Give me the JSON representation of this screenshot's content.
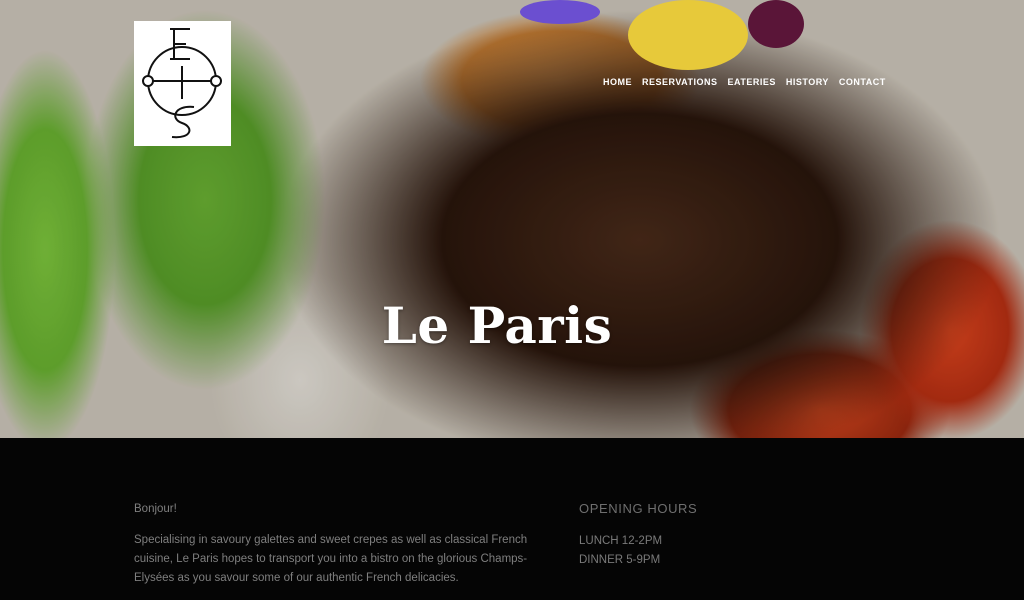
{
  "header": {
    "logo_alt": "LE PARIS monogram logo",
    "nav": [
      "HOME",
      "RESERVATIONS",
      "EATERIES",
      "HISTORY",
      "CONTACT"
    ]
  },
  "hero": {
    "title": "Le Paris"
  },
  "about": {
    "greeting": "Bonjour!",
    "body": "Specialising in savoury galettes and sweet crepes as well as classical French cuisine, Le Paris hopes to transport you into a bistro on the glorious Champs-Elysées as you savour some of our authentic French delicacies."
  },
  "opening_hours": {
    "heading": "OPENING HOURS",
    "lines": [
      "LUNCH 12-2PM",
      "DINNER 5-9PM"
    ]
  }
}
